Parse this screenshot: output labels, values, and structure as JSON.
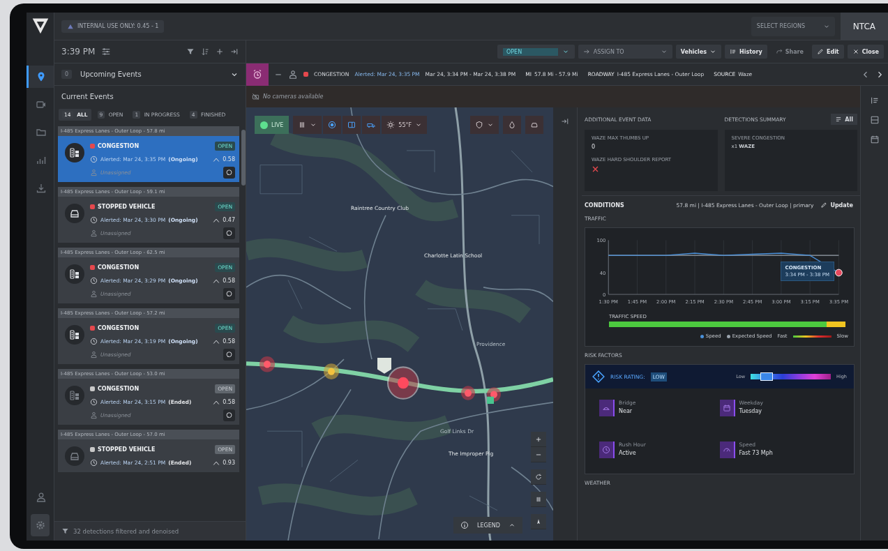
{
  "rail": {
    "nav": [
      {
        "kind": "pin",
        "selected": true
      },
      {
        "kind": "video",
        "selected": false
      },
      {
        "kind": "folder",
        "selected": false
      },
      {
        "kind": "chart",
        "selected": false
      },
      {
        "kind": "download",
        "selected": false
      }
    ],
    "bottom": [
      {
        "kind": "user"
      },
      {
        "kind": "gear"
      }
    ]
  },
  "topbar": {
    "badge": "INTERNAL USE ONLY: 0.45 - 1",
    "region_select": {
      "placeholder": "SELECT REGIONS"
    },
    "org": "NTCA"
  },
  "left": {
    "time": "3:39 PM",
    "upcoming": {
      "count": "0",
      "label": "Upcoming Events"
    },
    "title": "Current Events",
    "filters": [
      {
        "count": "14",
        "label": "ALL",
        "selected": true
      },
      {
        "count": "9",
        "label": "OPEN",
        "selected": false
      },
      {
        "count": "1",
        "label": "IN PROGRESS",
        "selected": false
      },
      {
        "count": "4",
        "label": "FINISHED",
        "selected": false
      }
    ],
    "events": [
      {
        "road": "I-485 Express Lanes - Outer Loop - 57.8 mi",
        "kind": "congestion",
        "type": "CONGESTION",
        "color": "#e5484d",
        "alerted": "Alerted: Mar 24, 3:35 PM",
        "status": "(Ongoing)",
        "badge": "OPEN",
        "active": true,
        "score": "0.58",
        "assignee": "Unassigned",
        "selected": true
      },
      {
        "road": "I-485 Express Lanes - Outer Loop - 59.1 mi",
        "kind": "vehicle",
        "type": "STOPPED VEHICLE",
        "color": "#e5484d",
        "alerted": "Alerted: Mar 24, 3:30 PM",
        "status": "(Ongoing)",
        "badge": "OPEN",
        "active": true,
        "score": "0.47",
        "assignee": "Unassigned",
        "selected": false
      },
      {
        "road": "I-485 Express Lanes - Outer Loop - 62.5 mi",
        "kind": "congestion",
        "type": "CONGESTION",
        "color": "#e5484d",
        "alerted": "Alerted: Mar 24, 3:29 PM",
        "status": "(Ongoing)",
        "badge": "OPEN",
        "active": true,
        "score": "0.58",
        "assignee": "Unassigned",
        "selected": false
      },
      {
        "road": "I-485 Express Lanes - Outer Loop - 57.2 mi",
        "kind": "congestion",
        "type": "CONGESTION",
        "color": "#e5484d",
        "alerted": "Alerted: Mar 24, 3:19 PM",
        "status": "(Ongoing)",
        "badge": "OPEN",
        "active": true,
        "score": "0.58",
        "assignee": "Unassigned",
        "selected": false
      },
      {
        "road": "I-485 Express Lanes - Outer Loop - 53.0 mi",
        "kind": "congestion",
        "type": "CONGESTION",
        "color": "#c8c8c8",
        "alerted": "Alerted: Mar 24, 3:15 PM",
        "status": "(Ended)",
        "badge": "OPEN",
        "active": false,
        "score": "0.58",
        "assignee": "Unassigned",
        "selected": false
      },
      {
        "road": "I-485 Express Lanes - Outer Loop - 57.0 mi",
        "kind": "vehicle",
        "type": "STOPPED VEHICLE",
        "color": "#c8c8c8",
        "alerted": "Alerted: Mar 24, 2:51 PM",
        "status": "(Ended)",
        "badge": "OPEN",
        "active": false,
        "score": "0.93",
        "selected": false
      }
    ],
    "footer": "32 detections filtered and denoised"
  },
  "toolbar": {
    "status_select": "OPEN",
    "assign_select": {
      "placeholder": "ASSIGN TO"
    },
    "buttons": [
      {
        "kind": "dropdown",
        "label": "Vehicles",
        "disabled": false
      },
      {
        "kind": "history",
        "label": "History",
        "disabled": false
      },
      {
        "kind": "share",
        "label": "Share",
        "disabled": true
      },
      {
        "kind": "edit",
        "label": "Edit",
        "disabled": false
      },
      {
        "kind": "close",
        "label": "Close",
        "disabled": false
      }
    ]
  },
  "event_strip": {
    "type": "CONGESTION",
    "color": "#e5484d",
    "alerted": "Alerted: Mar 24, 3:35 PM",
    "range": "Mar 24, 3:34 PM - Mar 24, 3:38 PM",
    "fields": [
      {
        "label": "MI",
        "value": "57.8 Mi - 57.9 Mi"
      },
      {
        "label": "ROADWAY",
        "value": "I-485 Express Lanes - Outer Loop"
      },
      {
        "label": "SOURCE",
        "value": "Waze"
      }
    ]
  },
  "cameras": "No cameras available",
  "map": {
    "live": "LIVE",
    "temperature": "55°F",
    "legend": "LEGEND",
    "labels": [
      {
        "text": "Raintree Country Club",
        "kind": "place"
      },
      {
        "text": "Charlotte Latin School",
        "kind": "place"
      },
      {
        "text": "Providence",
        "kind": "road"
      },
      {
        "text": "Golf Links Dr",
        "kind": "road"
      },
      {
        "text": "The Improper Pig",
        "kind": "place"
      }
    ]
  },
  "details": {
    "additional": {
      "title": "ADDITIONAL EVENT DATA",
      "fields": [
        {
          "label": "WAZE MAX THUMBS UP",
          "kind": "text",
          "value": "0"
        },
        {
          "label": "WAZE HARD SHOULDER REPORT",
          "kind": "cross"
        }
      ]
    },
    "detections": {
      "title": "DETECTIONS SUMMARY",
      "all_button": "All",
      "items": [
        {
          "name": "SEVERE CONGESTION",
          "count": "x1 **WAZE**"
        }
      ]
    },
    "conditions": {
      "title": "CONDITIONS",
      "location": "57.8 mi | I-485 Express Lanes - Outer Loop | primary",
      "update_button": "Update"
    },
    "traffic": {
      "title": "TRAFFIC",
      "chart_data": {
        "type": "line",
        "categories": [
          "1:30 PM",
          "1:45 PM",
          "2:00 PM",
          "2:15 PM",
          "2:30 PM",
          "2:45 PM",
          "3:00 PM",
          "3:15 PM",
          "3:35 PM"
        ],
        "ylim": [
          0,
          100
        ],
        "yticks": [
          0,
          40,
          100
        ],
        "series": [
          {
            "name": "Speed",
            "color": "#4a90d9",
            "values": [
              72,
              72,
              72,
              76,
              72,
              74,
              76,
              72,
              40
            ]
          },
          {
            "name": "Expected Speed",
            "color": "#9aa3ad",
            "values": [
              72,
              72,
              72,
              72,
              72,
              72,
              72,
              72,
              72
            ]
          }
        ],
        "grid": true,
        "annotations": [
          {
            "text": "CONGESTION"
          },
          {
            "text": "3:34 PM - 3:38 PM"
          }
        ]
      },
      "speed_title": "TRAFFIC SPEED",
      "speed_bar": {
        "level": 0.92
      },
      "legend": {
        "fast": "Fast",
        "slow": "Slow"
      }
    },
    "risk": {
      "title": "RISK FACTORS",
      "rating_label": "RISK RATING:",
      "rating": "LOW",
      "low": "Low",
      "high": "High",
      "scale": {
        "level": 0.2
      },
      "factors": [
        {
          "label": "Bridge",
          "value": "Near",
          "kind": "bridge"
        },
        {
          "label": "Weekday",
          "value": "Tuesday",
          "kind": "calendar"
        },
        {
          "label": "Rush Hour",
          "value": "Active",
          "kind": "clock"
        },
        {
          "label": "Speed",
          "value": "Fast 73 Mph",
          "kind": "gauge"
        }
      ]
    },
    "weather": {
      "title": "WEATHER"
    }
  }
}
